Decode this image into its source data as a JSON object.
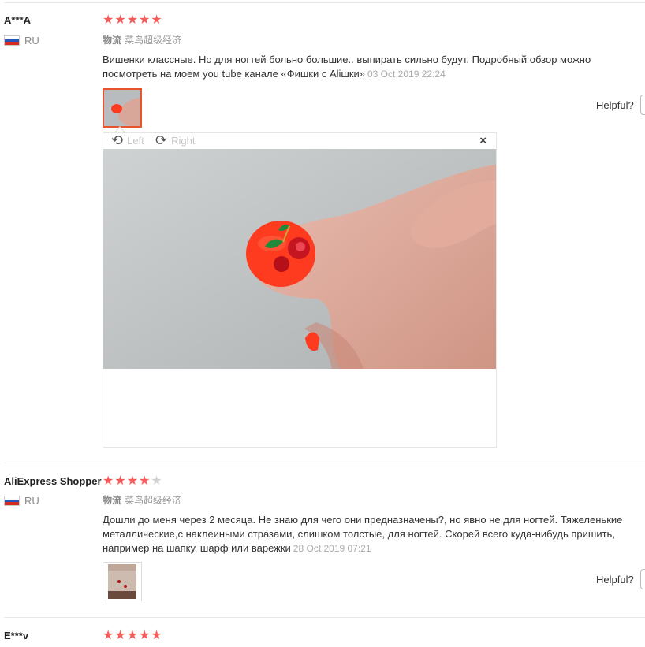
{
  "reviews": [
    {
      "user": "A***A",
      "country": "RU",
      "rating": 5,
      "logistics_label": "物流",
      "logistics_value": "菜鸟超级经济",
      "text": "Вишенки классные. Но для ногтей больно большие.. выпирать сильно будут. Подробный обзор можно посмотреть на моем you tube канале «Фишки с Aliшки»",
      "date": "03 Oct 2019 22:24",
      "helpful_label": "Helpful?"
    },
    {
      "user": "AliExpress Shopper",
      "country": "RU",
      "rating": 4,
      "logistics_label": "物流",
      "logistics_value": "菜鸟超级经济",
      "text": "Дошли до меня через 2 месяца. Не знаю для чего они предназначены?, но явно не для ногтей. Тяжеленькие металлические,с наклеиными стразами, слишком толстые, для ногтей. Скорей всего куда-нибудь пришить, например на шапку, шарф или варежки",
      "date": "28 Oct 2019 07:21",
      "helpful_label": "Helpful?"
    },
    {
      "user": "E***v",
      "rating": 5
    }
  ],
  "viewer": {
    "rotate_left_label": "Left",
    "rotate_right_label": "Right",
    "close_symbol": "×"
  },
  "icons": {
    "star": "star-icon",
    "flag": "russia-flag-icon",
    "rotate_left": "rotate-left-icon",
    "rotate_right": "rotate-right-icon",
    "close": "close-icon"
  },
  "colors": {
    "star_on": "#f55b5b",
    "star_off": "#d2d2d2",
    "active_thumb_border": "#e8542c",
    "nail": "#ff3b1f"
  }
}
